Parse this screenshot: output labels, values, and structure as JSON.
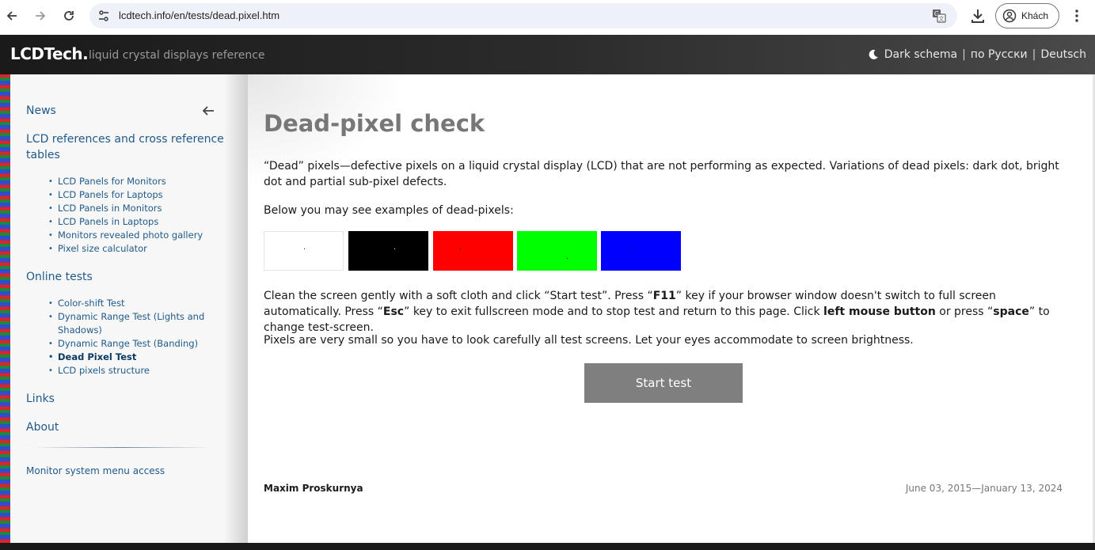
{
  "browser": {
    "url": "lcdtech.info/en/tests/dead.pixel.htm",
    "profile_label": "Khách",
    "icons": [
      "back-icon",
      "forward-icon",
      "reload-icon",
      "tune-icon",
      "translate-icon",
      "download-icon",
      "profile-icon",
      "menu-icon"
    ]
  },
  "header": {
    "logo": "LCDTech",
    "logo_dot": ".",
    "tagline": "liquid crystal displays reference",
    "dark_schema": "Dark schema",
    "sep1": "|",
    "russian": "по Русски",
    "sep2": "|",
    "deutsch": "Deutsch"
  },
  "sidebar": {
    "news": "News",
    "lcd_refs": "LCD references and cross reference tables",
    "lcd_items": [
      "LCD Panels for Monitors",
      "LCD Panels for Laptops",
      "LCD Panels in Monitors",
      "LCD Panels in Laptops",
      "Monitors revealed photo gallery",
      "Pixel size calculator"
    ],
    "online_tests": "Online tests",
    "test_items": [
      "Color-shift Test",
      "Dynamic Range Test (Lights and Shadows)",
      "Dynamic Range Test (Banding)",
      "Dead Pixel Test",
      "LCD pixels structure"
    ],
    "active_test": "Dead Pixel Test",
    "links": "Links",
    "about": "About",
    "monitor_menu": "Monitor system menu access"
  },
  "main": {
    "title": "Dead-pixel check",
    "intro": "“Dead” pixels—defective pixels on a liquid crystal display (LCD) that are not performing as expected. Variations of dead pixels: dark dot, bright dot and partial sub-pixel defects.",
    "examples_label": "Below you may see examples of dead-pixels:",
    "swatches": [
      {
        "name": "white",
        "bg": "#ffffff",
        "dot": "#000000"
      },
      {
        "name": "black",
        "bg": "#000000",
        "dot": "#ffffff"
      },
      {
        "name": "red",
        "bg": "#ff0000",
        "dot": "#000000"
      },
      {
        "name": "green",
        "bg": "#00ff00",
        "dot": "#000000"
      },
      {
        "name": "blue",
        "bg": "#0000ff",
        "dot": "#000000"
      }
    ],
    "instr_1a": "Clean the screen gently with a soft cloth and click “Start test”. Press “",
    "instr_key_f11": "F11",
    "instr_1b": "” key if your browser window doesn't switch to full screen automatically. Press “",
    "instr_key_esc": "Esc",
    "instr_1c": "” key to exit fullscreen mode and to stop test and return to this page. Click ",
    "instr_mouse": "left mouse button",
    "instr_1d": " or press “",
    "instr_key_space": "space",
    "instr_1e": "” to change test-screen.",
    "accommodate": "Pixels are very small so you have to look carefully all test screens. Let your eyes accommodate to screen brightness.",
    "start_button": "Start test",
    "author": "Maxim Proskurnya",
    "dates": "June 03, 2015—January 13, 2024"
  }
}
